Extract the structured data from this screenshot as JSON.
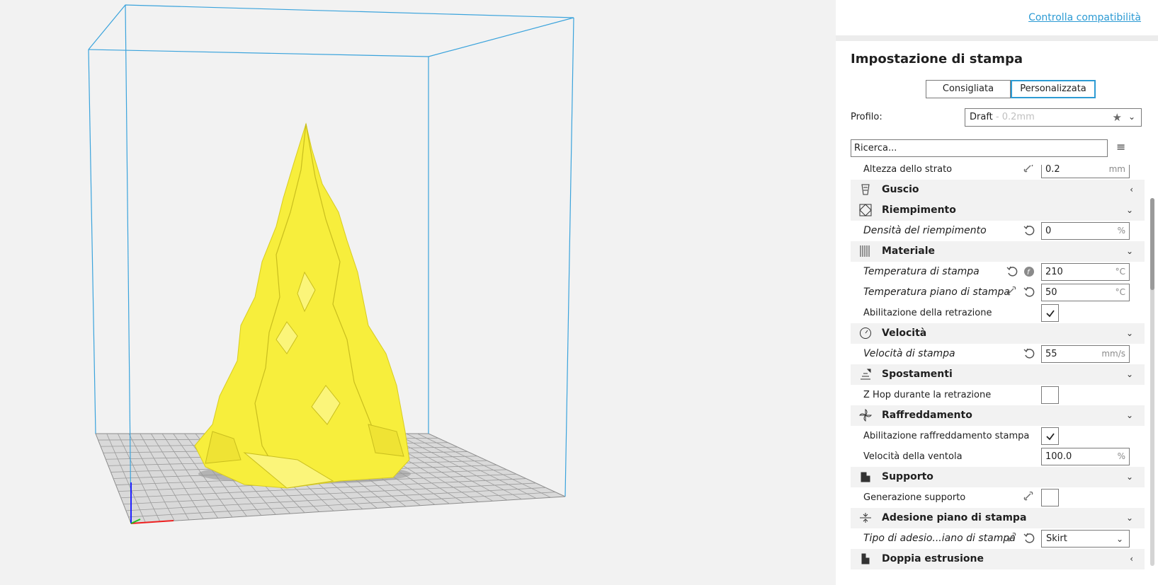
{
  "compat": {
    "link": "Controlla compatibilità"
  },
  "settings": {
    "title": "Impostazione di stampa",
    "modes": [
      "Consigliata",
      "Personalizzata"
    ],
    "active_mode": "Personalizzata",
    "profile_label": "Profilo:",
    "profile_value": "Draft",
    "profile_sub": " - 0.2mm",
    "search_value": "Ricerca..."
  },
  "rows": {
    "layer_height": {
      "label": "Altezza dello strato",
      "value": "0.2",
      "unit": "mm"
    },
    "shell": {
      "label": "Guscio",
      "icon": "shell-icon"
    },
    "infill": {
      "label": "Riempimento",
      "icon": "infill-icon"
    },
    "infill_density": {
      "label": "Densità del riempimento",
      "value": "0",
      "unit": "%"
    },
    "material": {
      "label": "Materiale",
      "icon": "material-icon"
    },
    "print_temp": {
      "label": "Temperatura di stampa",
      "value": "210",
      "unit": "°C"
    },
    "bed_temp": {
      "label": "Temperatura piano di stampa",
      "value": "50",
      "unit": "°C"
    },
    "retraction": {
      "label": "Abilitazione della retrazione",
      "checked": true
    },
    "speed": {
      "label": "Velocità",
      "icon": "speed-icon"
    },
    "print_speed": {
      "label": "Velocità di stampa",
      "value": "55",
      "unit": "mm/s"
    },
    "travel": {
      "label": "Spostamenti",
      "icon": "travel-icon"
    },
    "zhop": {
      "label": "Z Hop durante la retrazione",
      "checked": false
    },
    "cooling": {
      "label": "Raffreddamento",
      "icon": "fan-icon"
    },
    "cooling_enable": {
      "label": "Abilitazione raffreddamento stampa",
      "checked": true
    },
    "fan_speed": {
      "label": "Velocità della ventola",
      "value": "100.0",
      "unit": "%"
    },
    "support": {
      "label": "Supporto",
      "icon": "support-icon"
    },
    "support_gen": {
      "label": "Generazione supporto",
      "checked": false
    },
    "adhesion": {
      "label": "Adesione piano di stampa",
      "icon": "adhesion-icon"
    },
    "adhesion_type": {
      "label": "Tipo di adesio...iano di stampa",
      "value": "Skirt"
    },
    "dual": {
      "label": "Doppia estrusione",
      "icon": "dual-extrusion-icon"
    }
  },
  "colors": {
    "accent": "#2d9bd4",
    "model": "#f7ee3c",
    "build_volume": "#3aa3dc"
  }
}
